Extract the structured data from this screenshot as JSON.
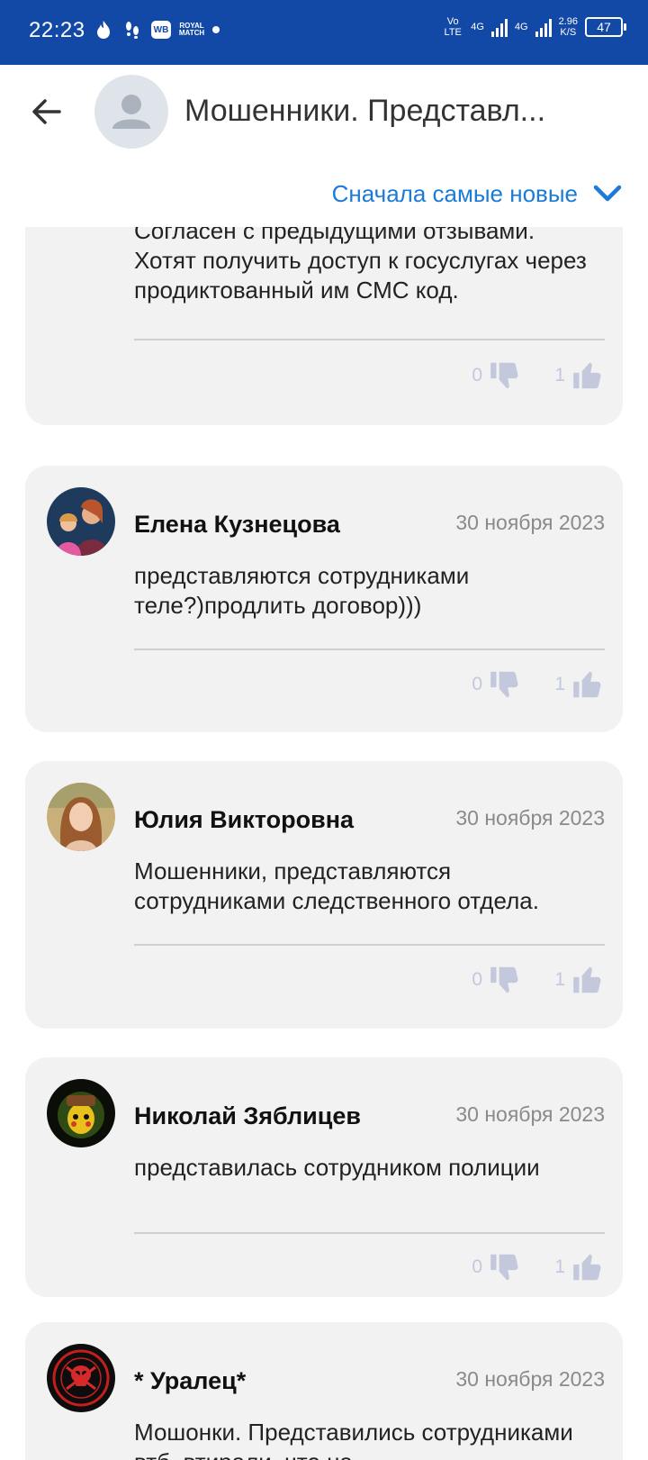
{
  "status_bar": {
    "time": "22:23",
    "wb_label": "WB",
    "royal_label": "ROYAL MATCH",
    "volte_label": "Vo LTE",
    "net1": "4G",
    "net2": "4G",
    "speed_value": "2.96",
    "speed_unit": "K/S",
    "battery": "47"
  },
  "header": {
    "title": "Мошенники. Представл..."
  },
  "sort": {
    "label": "Сначала самые новые"
  },
  "reviews": [
    {
      "author": "",
      "date": "",
      "text": "Согласен с предыдущими отзывами. Хотят получить доступ к госуслугах через продиктованный им СМС код.",
      "dislikes": "0",
      "likes": "1"
    },
    {
      "author": "Елена Кузнецова",
      "date": "30 ноября 2023",
      "text": "представляются сотрудниками теле?)продлить договор)))",
      "dislikes": "0",
      "likes": "1"
    },
    {
      "author": "Юлия Викторовна",
      "date": "30 ноября 2023",
      "text": "Мошенники, представляются сотрудниками следственного отдела.",
      "dislikes": "0",
      "likes": "1"
    },
    {
      "author": "Николай Зяблицев",
      "date": "30 ноября 2023",
      "text": "представилась сотрудником полиции",
      "dislikes": "0",
      "likes": "1"
    },
    {
      "author": "* Уралец*",
      "date": "30 ноября 2023",
      "text": "Мошонки. Представились сотрудниками втб, втирали, что на",
      "dislikes": "",
      "likes": ""
    }
  ],
  "colors": {
    "status_bar": "#1349a6",
    "accent": "#1b7bd6",
    "card_bg": "#f2f2f2",
    "vote": "#c3c8dc"
  }
}
